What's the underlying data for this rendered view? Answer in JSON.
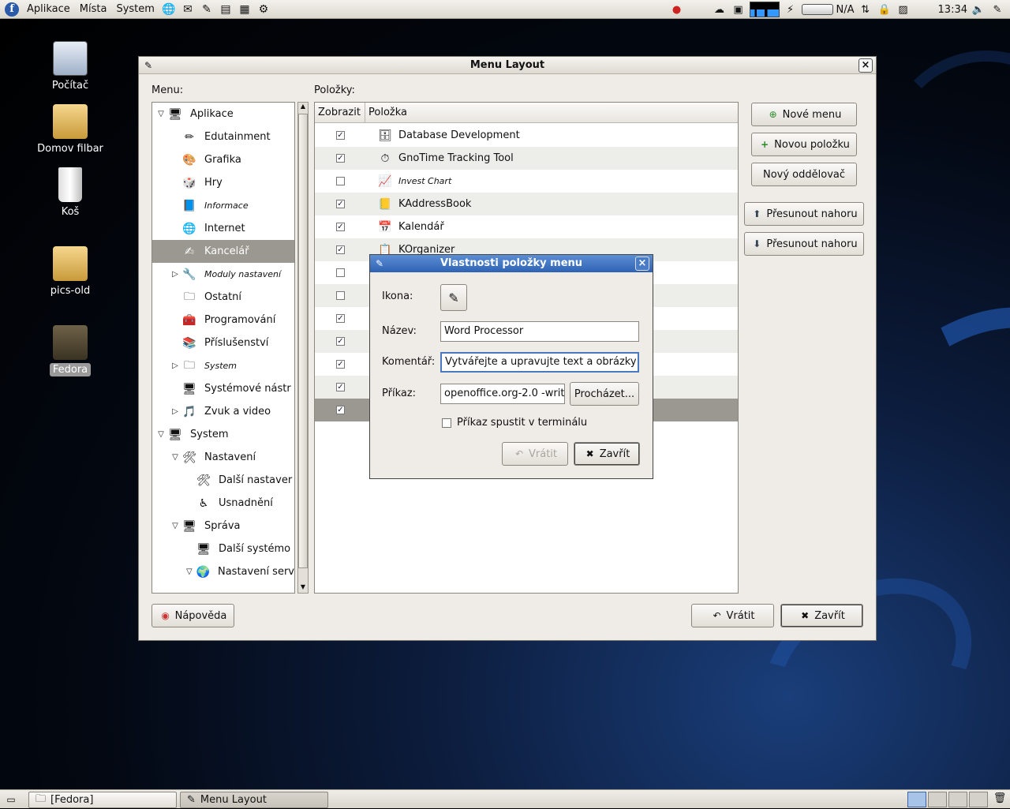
{
  "top_panel": {
    "menus": [
      "Aplikace",
      "Místa",
      "System"
    ],
    "launchers": [
      "web-browser-icon",
      "email-icon",
      "writer-icon",
      "impress-icon",
      "calc-icon",
      "settings-icon"
    ],
    "battery_status": "N/A",
    "clock": "13:34"
  },
  "desktop_icons": [
    {
      "label": "Počítač",
      "icon": "computer-icon"
    },
    {
      "label": "Domov filbar",
      "icon": "home-folder-icon"
    },
    {
      "label": "Koš",
      "icon": "trash-icon"
    },
    {
      "label": "pics-old",
      "icon": "folder-icon"
    },
    {
      "label": "Fedora",
      "icon": "folder-icon",
      "selected": true
    }
  ],
  "menu_layout": {
    "title": "Menu Layout",
    "menu_label": "Menu:",
    "items_label": "Položky:",
    "tree": [
      {
        "label": "Aplikace",
        "level": 0,
        "expander": "open"
      },
      {
        "label": "Edutainment",
        "level": 1
      },
      {
        "label": "Grafika",
        "level": 1
      },
      {
        "label": "Hry",
        "level": 1
      },
      {
        "label": "Informace",
        "level": 1,
        "italic": true
      },
      {
        "label": "Internet",
        "level": 1
      },
      {
        "label": "Kancelář",
        "level": 1,
        "selected": true
      },
      {
        "label": "Moduly nastavení",
        "level": 1,
        "expander": "closed",
        "italic": true
      },
      {
        "label": "Ostatní",
        "level": 1
      },
      {
        "label": "Programování",
        "level": 1
      },
      {
        "label": "Příslušenství",
        "level": 1
      },
      {
        "label": "System",
        "level": 1,
        "expander": "closed",
        "italic": true
      },
      {
        "label": "Systémové nástr",
        "level": 1
      },
      {
        "label": "Zvuk a video",
        "level": 1,
        "expander": "closed"
      },
      {
        "label": "System",
        "level": 0,
        "expander": "open"
      },
      {
        "label": "Nastavení",
        "level": 1,
        "expander": "open"
      },
      {
        "label": "Další nastaver",
        "level": 2
      },
      {
        "label": "Usnadnění",
        "level": 2
      },
      {
        "label": "Správa",
        "level": 1,
        "expander": "open"
      },
      {
        "label": "Další systémo",
        "level": 2
      },
      {
        "label": "Nastavení serv",
        "level": 2,
        "expander": "open"
      }
    ],
    "columns": {
      "show": "Zobrazit",
      "item": "Položka"
    },
    "items": [
      {
        "label": "Database Development",
        "checked": true
      },
      {
        "label": "GnoTime Tracking Tool",
        "checked": true
      },
      {
        "label": "Invest Chart",
        "checked": false,
        "italic": true
      },
      {
        "label": "KAddressBook",
        "checked": true
      },
      {
        "label": "Kalendář",
        "checked": true
      },
      {
        "label": "KOrganizer",
        "checked": true
      },
      {
        "label": "",
        "checked": false
      },
      {
        "label": "",
        "checked": false
      },
      {
        "label": "",
        "checked": true
      },
      {
        "label": "",
        "checked": true
      },
      {
        "label": "",
        "checked": true
      },
      {
        "label": "",
        "checked": true
      },
      {
        "label": "",
        "checked": true,
        "selected": true
      }
    ],
    "buttons": {
      "new_menu": "Nové menu",
      "new_item": "Novou položku",
      "new_separator": "Nový oddělovač",
      "move_up": "Přesunout nahoru",
      "move_down": "Přesunout nahoru",
      "help": "Nápověda",
      "revert": "Vrátit",
      "close": "Zavřít"
    }
  },
  "item_dialog": {
    "title": "Vlastnosti položky menu",
    "icon_label": "Ikona:",
    "name_label": "Název:",
    "name_value": "Word Processor",
    "comment_label": "Komentář:",
    "comment_value": "Vytvářejte a upravujte text a obrázky v",
    "command_label": "Příkaz:",
    "command_value": "openoffice.org-2.0 -writ",
    "browse": "Procházet...",
    "terminal_label": "Příkaz spustit v terminálu",
    "revert": "Vrátit",
    "close": "Zavřít"
  },
  "bottom_panel": {
    "tasks": [
      "[Fedora]",
      "Menu Layout"
    ]
  },
  "colors": {
    "selection": "#9a9890",
    "dialog_title": "#2e63b4",
    "panel": "#dcd8cf"
  }
}
